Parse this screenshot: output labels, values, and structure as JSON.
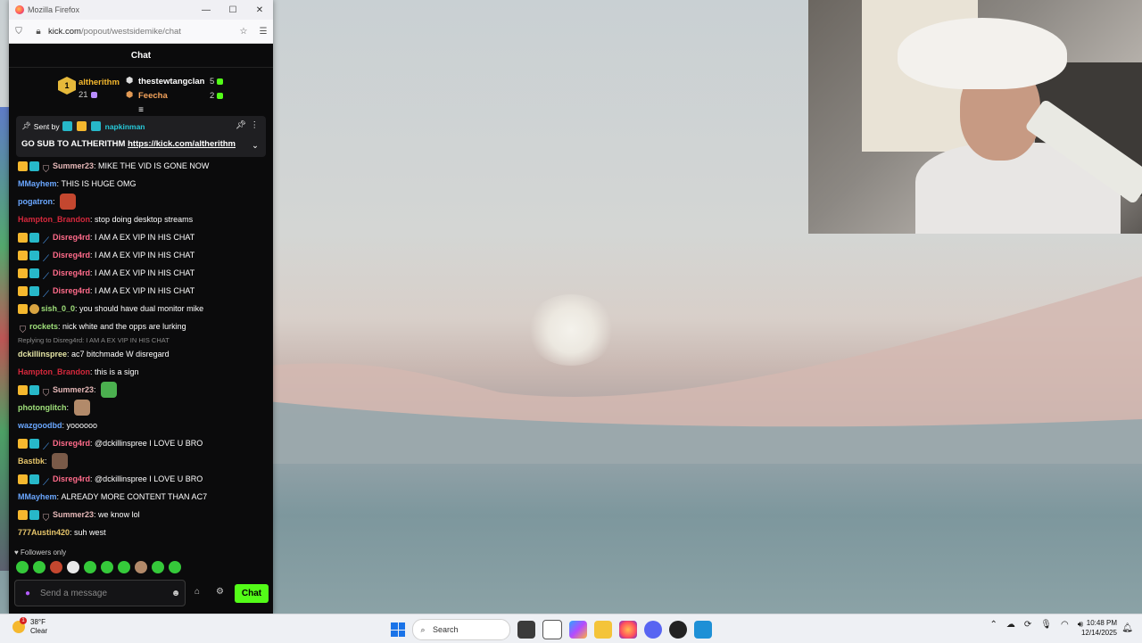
{
  "window": {
    "title": "Mozilla Firefox",
    "url_host": "kick.com",
    "url_path": "/popout/westsidemike/chat"
  },
  "chat": {
    "header": "Chat",
    "leaderboard": [
      {
        "rank": "1",
        "name": "altherithm",
        "count": "21"
      },
      {
        "name": "thestewtangclan",
        "count": "5"
      },
      {
        "name": "Feecha",
        "count": "2"
      }
    ],
    "pinned": {
      "sent_by_label": "Sent by",
      "sender": "napkinman",
      "text": "GO SUB TO ALTHERITHM",
      "link": "https://kick.com/altherithm"
    },
    "messages": [
      {
        "user": "Summer23",
        "color": "#e6b8b8",
        "badges": [
          "crown",
          "sub",
          "shield"
        ],
        "text": "MIKE THE VID IS GONE NOW"
      },
      {
        "user": "MMayhem",
        "color": "#6aa7ff",
        "badges": [],
        "text": "THIS IS HUGE OMG"
      },
      {
        "user": "pogatron",
        "color": "#6aa7ff",
        "badges": [],
        "text": "",
        "emote": "#c4472f"
      },
      {
        "user": "Hampton_Brandon",
        "color": "#d6283c",
        "badges": [],
        "text": "stop doing desktop streams"
      },
      {
        "user": "Disreg4rd",
        "color": "#ff6b8a",
        "badges": [
          "crown",
          "sub",
          "sword"
        ],
        "text": "I AM A EX VIP IN HIS CHAT"
      },
      {
        "user": "Disreg4rd",
        "color": "#ff6b8a",
        "badges": [
          "crown",
          "sub",
          "sword"
        ],
        "text": "I AM A EX VIP IN HIS CHAT"
      },
      {
        "user": "Disreg4rd",
        "color": "#ff6b8a",
        "badges": [
          "crown",
          "sub",
          "sword"
        ],
        "text": "I AM A EX VIP IN HIS CHAT"
      },
      {
        "user": "Disreg4rd",
        "color": "#ff6b8a",
        "badges": [
          "crown",
          "sub",
          "sword"
        ],
        "text": "I AM A EX VIP IN HIS CHAT"
      },
      {
        "user": "sish_0_0",
        "color": "#9fe07a",
        "badges": [
          "crown",
          "bot"
        ],
        "text": "you should have dual monitor mike"
      },
      {
        "user": "rockets",
        "color": "#9fe07a",
        "badges": [
          "shield"
        ],
        "text": "nick white and the opps are lurking"
      },
      {
        "reply": "Replying to Disreg4rd: I AM A EX VIP IN HIS CHAT",
        "user": "dckillinspree",
        "color": "#e6e6a6",
        "badges": [],
        "text": "ac7 bitchmade W disregard"
      },
      {
        "user": "Hampton_Brandon",
        "color": "#d6283c",
        "badges": [],
        "text": "this is a sign"
      },
      {
        "user": "Summer23",
        "color": "#e6b8b8",
        "badges": [
          "crown",
          "sub",
          "shield"
        ],
        "text": "",
        "emote": "#4bb04f"
      },
      {
        "user": "photonglitch",
        "color": "#9fe07a",
        "badges": [],
        "text": "",
        "emote": "#b28a6a"
      },
      {
        "user": "wazgoodbd",
        "color": "#6aa7ff",
        "badges": [],
        "text": "yoooooo"
      },
      {
        "user": "Disreg4rd",
        "color": "#ff6b8a",
        "badges": [
          "crown",
          "sub",
          "sword"
        ],
        "text": "@dckillinspree I LOVE U BRO"
      },
      {
        "user": "Bastbk",
        "color": "#e6c56a",
        "badges": [],
        "text": "",
        "emote": "#7a5a48"
      },
      {
        "user": "Disreg4rd",
        "color": "#ff6b8a",
        "badges": [
          "crown",
          "sub",
          "sword"
        ],
        "text": "@dckillinspree I LOVE U BRO"
      },
      {
        "user": "MMayhem",
        "color": "#6aa7ff",
        "badges": [],
        "text": "ALREADY MORE CONTENT THAN AC7"
      },
      {
        "user": "Summer23",
        "color": "#e6b8b8",
        "badges": [
          "crown",
          "sub",
          "shield"
        ],
        "text": "we know lol"
      },
      {
        "user": "777Austin420",
        "color": "#e6c56a",
        "badges": [],
        "text": "suh west"
      }
    ],
    "followers_only": "Followers only",
    "composer_placeholder": "Send a message",
    "send_label": "Chat"
  },
  "taskbar": {
    "temp": "38°F",
    "weather": "Clear",
    "search_label": "Search",
    "time": "10:48 PM",
    "date": "12/14/2025"
  },
  "colors": {
    "kick_green": "#53fc18",
    "chat_bg": "#0b0b0c"
  }
}
